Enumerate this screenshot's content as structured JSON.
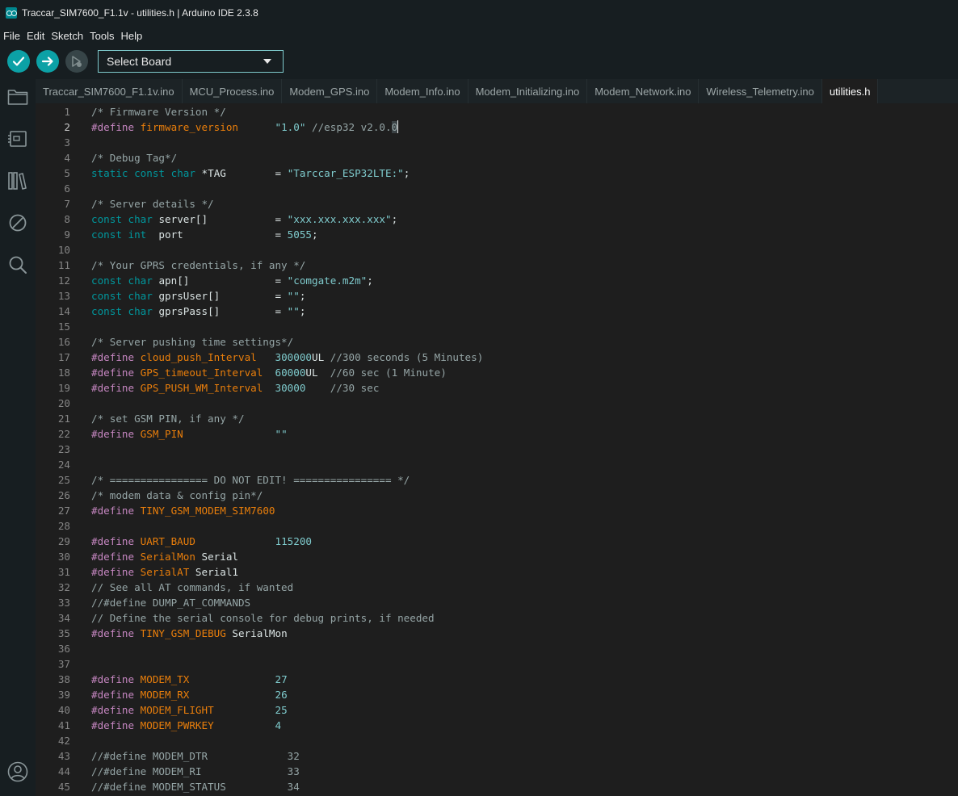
{
  "window": {
    "title": "Traccar_SIM7600_F1.1v - utilities.h | Arduino IDE 2.3.8"
  },
  "menu": [
    "File",
    "Edit",
    "Sketch",
    "Tools",
    "Help"
  ],
  "toolbar": {
    "board_label": "Select Board"
  },
  "tabs": [
    {
      "label": "Traccar_SIM7600_F1.1v.ino",
      "active": false
    },
    {
      "label": "MCU_Process.ino",
      "active": false
    },
    {
      "label": "Modem_GPS.ino",
      "active": false
    },
    {
      "label": "Modem_Info.ino",
      "active": false
    },
    {
      "label": "Modem_Initializing.ino",
      "active": false
    },
    {
      "label": "Modem_Network.ino",
      "active": false
    },
    {
      "label": "Wireless_Telemetry.ino",
      "active": false
    },
    {
      "label": "utilities.h",
      "active": true
    }
  ],
  "colors": {
    "keyword": "#c586c0",
    "type": "#00979d",
    "macro": "#e97e0b",
    "string": "#7fcbcd",
    "number": "#7fcbcd",
    "comment": "#95a5a6",
    "plain": "#dae3e3"
  },
  "editor": {
    "current_line": 2,
    "lines": [
      [
        {
          "c": "comment",
          "t": "/* Firmware Version */"
        }
      ],
      [
        {
          "c": "keyword",
          "t": "#define"
        },
        {
          "c": "plain",
          "t": " "
        },
        {
          "c": "macro",
          "t": "firmware_version"
        },
        {
          "c": "plain",
          "t": "      "
        },
        {
          "c": "string",
          "t": "\"1.0\""
        },
        {
          "c": "comment",
          "t": " //esp32 v2.0."
        },
        {
          "c": "comment-hl",
          "t": "0"
        }
      ],
      [],
      [
        {
          "c": "comment",
          "t": "/* Debug Tag*/"
        }
      ],
      [
        {
          "c": "type",
          "t": "static"
        },
        {
          "c": "plain",
          "t": " "
        },
        {
          "c": "type",
          "t": "const"
        },
        {
          "c": "plain",
          "t": " "
        },
        {
          "c": "type",
          "t": "char"
        },
        {
          "c": "plain",
          "t": " *TAG        = "
        },
        {
          "c": "string",
          "t": "\"Tarccar_ESP32LTE:\""
        },
        {
          "c": "plain",
          "t": ";"
        }
      ],
      [],
      [
        {
          "c": "comment",
          "t": "/* Server details */"
        }
      ],
      [
        {
          "c": "type",
          "t": "const"
        },
        {
          "c": "plain",
          "t": " "
        },
        {
          "c": "type",
          "t": "char"
        },
        {
          "c": "plain",
          "t": " server[]           = "
        },
        {
          "c": "string",
          "t": "\"xxx.xxx.xxx.xxx\""
        },
        {
          "c": "plain",
          "t": ";"
        }
      ],
      [
        {
          "c": "type",
          "t": "const"
        },
        {
          "c": "plain",
          "t": " "
        },
        {
          "c": "type",
          "t": "int"
        },
        {
          "c": "plain",
          "t": "  port               = "
        },
        {
          "c": "number",
          "t": "5055"
        },
        {
          "c": "plain",
          "t": ";"
        }
      ],
      [],
      [
        {
          "c": "comment",
          "t": "/* Your GPRS credentials, if any */"
        }
      ],
      [
        {
          "c": "type",
          "t": "const"
        },
        {
          "c": "plain",
          "t": " "
        },
        {
          "c": "type",
          "t": "char"
        },
        {
          "c": "plain",
          "t": " apn[]              = "
        },
        {
          "c": "string",
          "t": "\"comgate.m2m\""
        },
        {
          "c": "plain",
          "t": ";"
        }
      ],
      [
        {
          "c": "type",
          "t": "const"
        },
        {
          "c": "plain",
          "t": " "
        },
        {
          "c": "type",
          "t": "char"
        },
        {
          "c": "plain",
          "t": " gprsUser[]         = "
        },
        {
          "c": "string",
          "t": "\"\""
        },
        {
          "c": "plain",
          "t": ";"
        }
      ],
      [
        {
          "c": "type",
          "t": "const"
        },
        {
          "c": "plain",
          "t": " "
        },
        {
          "c": "type",
          "t": "char"
        },
        {
          "c": "plain",
          "t": " gprsPass[]         = "
        },
        {
          "c": "string",
          "t": "\"\""
        },
        {
          "c": "plain",
          "t": ";"
        }
      ],
      [],
      [
        {
          "c": "comment",
          "t": "/* Server pushing time settings*/"
        }
      ],
      [
        {
          "c": "keyword",
          "t": "#define"
        },
        {
          "c": "plain",
          "t": " "
        },
        {
          "c": "macro",
          "t": "cloud_push_Interval"
        },
        {
          "c": "plain",
          "t": "   "
        },
        {
          "c": "number",
          "t": "300000"
        },
        {
          "c": "plain",
          "t": "UL "
        },
        {
          "c": "comment",
          "t": "//300 seconds (5 Minutes)"
        }
      ],
      [
        {
          "c": "keyword",
          "t": "#define"
        },
        {
          "c": "plain",
          "t": " "
        },
        {
          "c": "macro",
          "t": "GPS_timeout_Interval"
        },
        {
          "c": "plain",
          "t": "  "
        },
        {
          "c": "number",
          "t": "60000"
        },
        {
          "c": "plain",
          "t": "UL  "
        },
        {
          "c": "comment",
          "t": "//60 sec (1 Minute)"
        }
      ],
      [
        {
          "c": "keyword",
          "t": "#define"
        },
        {
          "c": "plain",
          "t": " "
        },
        {
          "c": "macro",
          "t": "GPS_PUSH_WM_Interval"
        },
        {
          "c": "plain",
          "t": "  "
        },
        {
          "c": "number",
          "t": "30000"
        },
        {
          "c": "plain",
          "t": "    "
        },
        {
          "c": "comment",
          "t": "//30 sec"
        }
      ],
      [],
      [
        {
          "c": "comment",
          "t": "/* set GSM PIN, if any */"
        }
      ],
      [
        {
          "c": "keyword",
          "t": "#define"
        },
        {
          "c": "plain",
          "t": " "
        },
        {
          "c": "macro",
          "t": "GSM_PIN"
        },
        {
          "c": "plain",
          "t": "               "
        },
        {
          "c": "string",
          "t": "\"\""
        }
      ],
      [],
      [],
      [
        {
          "c": "comment",
          "t": "/* ================ DO NOT EDIT! ================ */"
        }
      ],
      [
        {
          "c": "comment",
          "t": "/* modem data & config pin*/"
        }
      ],
      [
        {
          "c": "keyword",
          "t": "#define"
        },
        {
          "c": "plain",
          "t": " "
        },
        {
          "c": "macro",
          "t": "TINY_GSM_MODEM_SIM7600"
        }
      ],
      [],
      [
        {
          "c": "keyword",
          "t": "#define"
        },
        {
          "c": "plain",
          "t": " "
        },
        {
          "c": "macro",
          "t": "UART_BAUD"
        },
        {
          "c": "plain",
          "t": "             "
        },
        {
          "c": "number",
          "t": "115200"
        }
      ],
      [
        {
          "c": "keyword",
          "t": "#define"
        },
        {
          "c": "plain",
          "t": " "
        },
        {
          "c": "macro",
          "t": "SerialMon"
        },
        {
          "c": "plain",
          "t": " Serial"
        }
      ],
      [
        {
          "c": "keyword",
          "t": "#define"
        },
        {
          "c": "plain",
          "t": " "
        },
        {
          "c": "macro",
          "t": "SerialAT"
        },
        {
          "c": "plain",
          "t": " Serial1"
        }
      ],
      [
        {
          "c": "comment",
          "t": "// See all AT commands, if wanted"
        }
      ],
      [
        {
          "c": "comment",
          "t": "//#define DUMP_AT_COMMANDS"
        }
      ],
      [
        {
          "c": "comment",
          "t": "// Define the serial console for debug prints, if needed"
        }
      ],
      [
        {
          "c": "keyword",
          "t": "#define"
        },
        {
          "c": "plain",
          "t": " "
        },
        {
          "c": "macro",
          "t": "TINY_GSM_DEBUG"
        },
        {
          "c": "plain",
          "t": " SerialMon"
        }
      ],
      [],
      [],
      [
        {
          "c": "keyword",
          "t": "#define"
        },
        {
          "c": "plain",
          "t": " "
        },
        {
          "c": "macro",
          "t": "MODEM_TX"
        },
        {
          "c": "plain",
          "t": "              "
        },
        {
          "c": "number",
          "t": "27"
        }
      ],
      [
        {
          "c": "keyword",
          "t": "#define"
        },
        {
          "c": "plain",
          "t": " "
        },
        {
          "c": "macro",
          "t": "MODEM_RX"
        },
        {
          "c": "plain",
          "t": "              "
        },
        {
          "c": "number",
          "t": "26"
        }
      ],
      [
        {
          "c": "keyword",
          "t": "#define"
        },
        {
          "c": "plain",
          "t": " "
        },
        {
          "c": "macro",
          "t": "MODEM_FLIGHT"
        },
        {
          "c": "plain",
          "t": "          "
        },
        {
          "c": "number",
          "t": "25"
        }
      ],
      [
        {
          "c": "keyword",
          "t": "#define"
        },
        {
          "c": "plain",
          "t": " "
        },
        {
          "c": "macro",
          "t": "MODEM_PWRKEY"
        },
        {
          "c": "plain",
          "t": "          "
        },
        {
          "c": "number",
          "t": "4"
        }
      ],
      [],
      [
        {
          "c": "comment",
          "t": "//#define MODEM_DTR             32"
        }
      ],
      [
        {
          "c": "comment",
          "t": "//#define MODEM_RI              33"
        }
      ],
      [
        {
          "c": "comment",
          "t": "//#define MODEM_STATUS          34"
        }
      ]
    ]
  }
}
